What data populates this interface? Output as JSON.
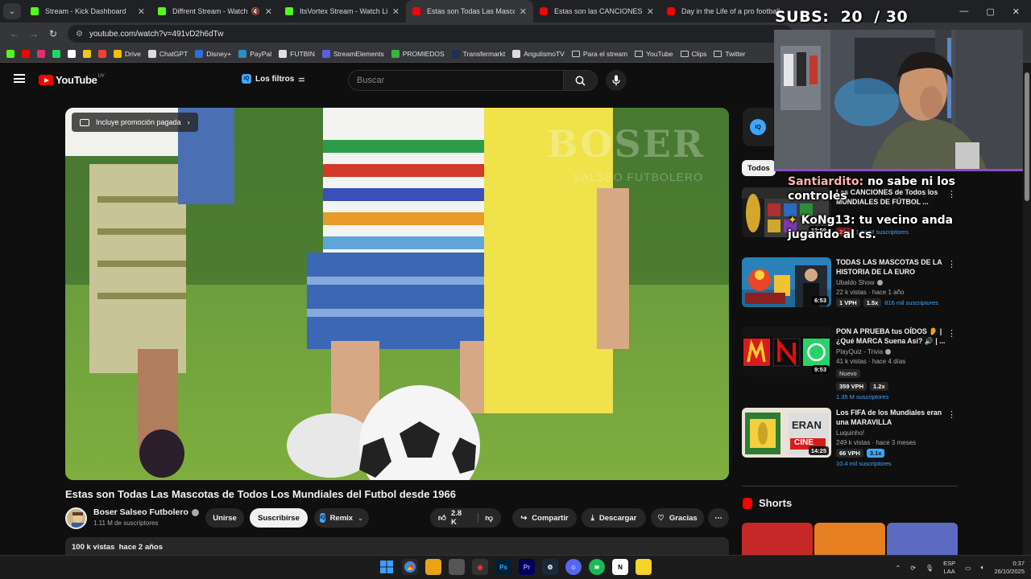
{
  "browser": {
    "tabs": [
      {
        "title": "Stream - Kick Dashboard",
        "favicon": "kick",
        "active": false
      },
      {
        "title": "Diffrent Stream - Watch Live",
        "favicon": "kick",
        "active": false,
        "muted": true
      },
      {
        "title": "ItsVortex Stream - Watch Live o",
        "favicon": "kick",
        "active": false
      },
      {
        "title": "Estas son Todas Las Mascotas d",
        "favicon": "youtube",
        "active": true
      },
      {
        "title": "Estas son las CANCIONES MÁS",
        "favicon": "youtube",
        "active": false
      },
      {
        "title": "Day in the Life of a pro football",
        "favicon": "youtube",
        "active": false
      }
    ],
    "url": "youtube.com/watch?v=491vD2h6dTw",
    "bookmarks": [
      {
        "label": "",
        "icon": "kick-icon",
        "color": "#53fc18"
      },
      {
        "label": "",
        "icon": "youtube-icon",
        "color": "#ff0000"
      },
      {
        "label": "",
        "icon": "instagram-icon",
        "color": "#e1306c"
      },
      {
        "label": "",
        "icon": "whatsapp-icon",
        "color": "#25d366"
      },
      {
        "label": "",
        "icon": "x-icon",
        "color": "#ffffff"
      },
      {
        "label": "",
        "icon": "bookmark-icon",
        "color": "#f5c518"
      },
      {
        "label": "",
        "icon": "gmail-icon",
        "color": "#ea4335"
      },
      {
        "label": "Drive",
        "icon": "drive-icon",
        "color": "#fbbc04"
      },
      {
        "label": "ChatGPT",
        "icon": "chatgpt-icon",
        "color": "#dddddd"
      },
      {
        "label": "Disney+",
        "icon": "disney-icon",
        "color": "#2b6fd6"
      },
      {
        "label": "PayPal",
        "icon": "paypal-icon",
        "color": "#2790c3"
      },
      {
        "label": "FUTBIN",
        "icon": "futbin-icon",
        "color": "#e0e0e0"
      },
      {
        "label": "StreamElements",
        "icon": "streamelements-icon",
        "color": "#5a5ee0"
      },
      {
        "label": "PROMIEDOS",
        "icon": "promiedos-icon",
        "color": "#3cb043"
      },
      {
        "label": "Transfermarkt",
        "icon": "transfermarkt-icon",
        "color": "#1a3151"
      },
      {
        "label": "AngulismoTV",
        "icon": "angulismo-icon",
        "color": "#dddddd"
      },
      {
        "label": "Para el stream",
        "icon": "folder-icon",
        "color": ""
      },
      {
        "label": "YouTube",
        "icon": "folder-icon",
        "color": ""
      },
      {
        "label": "Clips",
        "icon": "folder-icon",
        "color": ""
      },
      {
        "label": "Twitter",
        "icon": "folder-icon",
        "color": ""
      }
    ]
  },
  "youtube": {
    "logo_text": "YouTube",
    "country_code": "UY",
    "filters_label": "Los filtros",
    "search_placeholder": "Buscar",
    "video": {
      "promo_label": "Incluye promoción pagada",
      "watermark": "BOSER",
      "watermark_sub": "SALSEO FUTBOLERO",
      "title": "Estas son Todas Las Mascotas de Todos Los Mundiales del Futbol desde 1966",
      "channel_name": "Boser Salseo Futbolero",
      "channel_subs": "1.11 M de suscriptores",
      "join_label": "Unirse",
      "subscribe_label": "Suscribirse",
      "remix_label": "Remix",
      "likes": "2.8 K",
      "share_label": "Compartir",
      "download_label": "Descargar",
      "thanks_label": "Gracias",
      "views_line": "100 k vistas  hace 2 años"
    },
    "chip_all": "Todos",
    "recommendations": [
      {
        "title": "Las CANCIONES de Todos los MUNDIALES DE FÚTBOL ...",
        "channel": "",
        "views": "",
        "duration": "12:59",
        "tags": [
          "23x"
        ],
        "subs": "1.66 M suscriptores"
      },
      {
        "title": "TODAS LAS MASCOTAS DE LA HISTORIA DE LA EURO",
        "channel": "Ubaldo Show",
        "views": "22 k vistas · hace 1 año",
        "duration": "6:53",
        "tags": [
          "1 VPH",
          "1.5x"
        ],
        "subs": "816 mil suscriptores"
      },
      {
        "title": "PON A PRUEBA tus OÍDOS 👂 | ¿Qué MARCA Suena Así? 🔊 | ...",
        "channel": "PlayQuiz - Trivia",
        "views": "41 k vistas · hace 4 días",
        "duration": "9:53",
        "badge": "Nuevo",
        "tags": [
          "359 VPH",
          "1.2x"
        ],
        "subs": "1.35 M suscriptores"
      },
      {
        "title": "Los FIFA de los Mundiales eran una MARAVILLA",
        "channel": "Luquinho!",
        "views": "249 k vistas · hace 3 meses",
        "duration": "14:25",
        "tags": [
          "66 VPH",
          "3.1x"
        ],
        "subs": "10.4 mil suscriptores"
      }
    ],
    "shorts_label": "Shorts"
  },
  "stream_overlay": {
    "subs_text": "SUBS:  20  / 30",
    "chat": [
      {
        "user": "Santiardito:",
        "message": "no sabe ni los controles"
      },
      {
        "user": "KoNg13:",
        "message": "tu vecino anda jugando al cs."
      }
    ]
  },
  "taskbar": {
    "language_1": "ESP",
    "language_2": "LAA",
    "time": "0:37",
    "date": "26/10/2025"
  }
}
